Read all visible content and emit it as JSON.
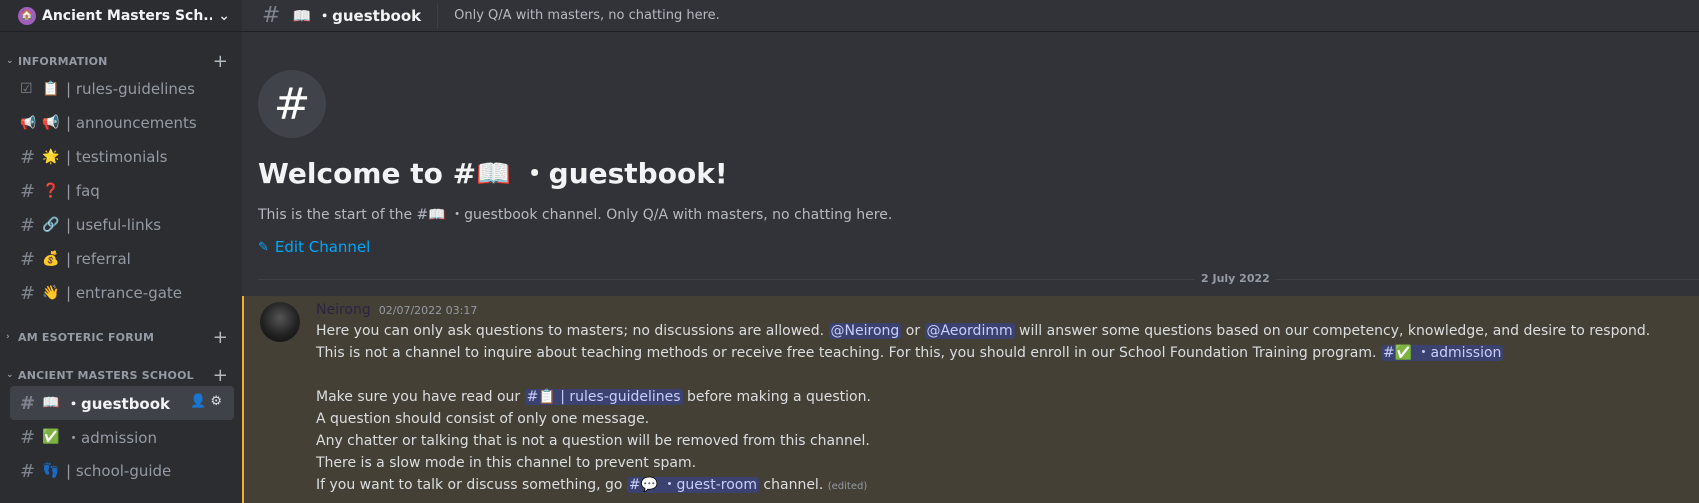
{
  "server": {
    "name": "Ancient Masters Sch...",
    "logo_emoji": "🏠"
  },
  "categories": [
    {
      "label": "INFORMATION",
      "channels": [
        {
          "type_icon": "☑",
          "emoji": "📋",
          "name": "| rules-guidelines"
        },
        {
          "type_icon": "📢",
          "emoji": "📢",
          "name": "| announcements"
        },
        {
          "type_icon": "#",
          "emoji": "🌟",
          "name": "| testimonials"
        },
        {
          "type_icon": "#",
          "emoji": "❓",
          "name": "| faq"
        },
        {
          "type_icon": "#",
          "emoji": "🔗",
          "name": "| useful-links"
        },
        {
          "type_icon": "#",
          "emoji": "💰",
          "name": "| referral"
        },
        {
          "type_icon": "#",
          "emoji": "👋",
          "name": "| entrance-gate"
        }
      ]
    },
    {
      "label": "AM ESOTERIC FORUM",
      "channels": []
    },
    {
      "label": "ANCIENT MASTERS SCHOOL",
      "channels": [
        {
          "type_icon": "#",
          "emoji": "📖",
          "name": "・guestbook",
          "active": true
        },
        {
          "type_icon": "#",
          "emoji": "✅",
          "name": "・admission"
        },
        {
          "type_icon": "#",
          "emoji": "👣",
          "name": "| school-guide"
        }
      ]
    }
  ],
  "topbar": {
    "hash": "#",
    "channel_emoji": "📖",
    "channel_name": "・guestbook",
    "topic": "Only Q/A with masters, no chatting here."
  },
  "welcome": {
    "heading": "Welcome to #📖 ・guestbook!",
    "description": "This is the start of the #📖 ・guestbook channel. Only Q/A with masters, no chatting here.",
    "edit_label": "Edit Channel"
  },
  "divider_date": "2 July 2022",
  "message": {
    "author": "Neirong",
    "timestamp": "02/07/2022 03:17",
    "l1_a": "Here you can only ask questions to masters; no discussions are allowed. ",
    "l1_m1": "@Neirong",
    "l1_b": " or ",
    "l1_m2": "@Aeordimm",
    "l1_c": " will answer some questions based on our competency, knowledge, and desire to respond.",
    "l2_a": "This is not a channel to inquire about teaching methods or receive free teaching. For this, you should enroll in our School Foundation Training program. ",
    "l2_ch": "#✅ ・admission",
    "l3_a": "Make sure you have read our ",
    "l3_ch": "#📋 | rules-guidelines",
    "l3_b": " before making a question.",
    "l4": "A question should consist of only one message.",
    "l5": "Any chatter or talking that is not a question will be removed from this channel.",
    "l6": "There is a slow mode in this channel to prevent spam.",
    "l7_a": "If you want to talk or discuss something, go ",
    "l7_ch": "#💬 ・guest-room",
    "l7_b": " channel. ",
    "edited": "(edited)"
  },
  "colors": {
    "accent_link": "#00a8fc",
    "highlight_bar": "#f0b232",
    "highlight_bg": "#444036"
  }
}
